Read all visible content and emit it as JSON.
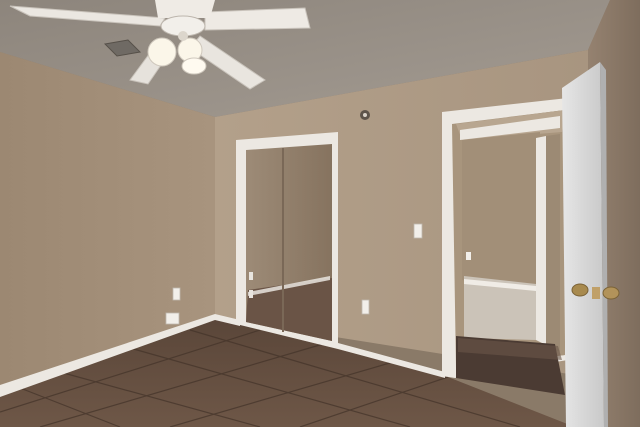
{
  "scene": {
    "subject": "empty-bedroom-interior",
    "colors": {
      "wall_left": "#a08c76",
      "wall_back": "#b09d87",
      "ceiling": "#9a9288",
      "floor_tile": "#6b5445",
      "trim": "#ece8e2",
      "mirror": "#8f7e6c",
      "hallway_wall": "#a8957d",
      "door": "#d8d8d8"
    },
    "objects": [
      "ceiling-fan",
      "ceiling-vent",
      "mirrored-closet-door",
      "open-bedroom-door",
      "hallway",
      "light-switch",
      "wall-outlet",
      "tile-floor",
      "baseboard",
      "smoke-detector"
    ]
  }
}
